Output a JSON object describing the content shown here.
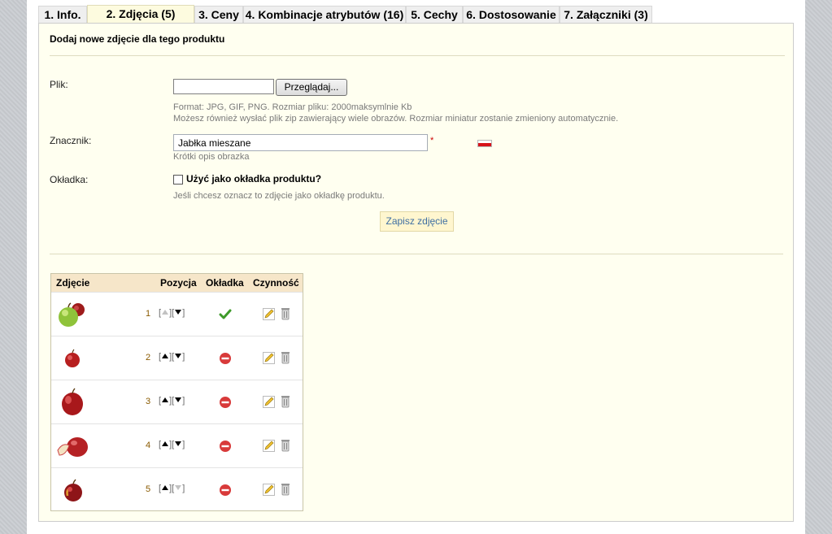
{
  "tabs": [
    {
      "label": "1. Info.",
      "active": false
    },
    {
      "label": "2. Zdjęcia (5)",
      "active": true
    },
    {
      "label": "3. Ceny",
      "active": false
    },
    {
      "label": "4. Kombinacje atrybutów (16)",
      "active": false
    },
    {
      "label": "5. Cechy",
      "active": false
    },
    {
      "label": "6. Dostosowanie",
      "active": false
    },
    {
      "label": "7. Załączniki (3)",
      "active": false
    }
  ],
  "form": {
    "heading": "Dodaj nowe zdjęcie dla tego produktu",
    "file_label": "Plik:",
    "browse_label": "Przeglądaj...",
    "file_hint_1": "Format: JPG, GIF, PNG. Rozmiar pliku: 2000maksymlnie Kb",
    "file_hint_2": "Możesz również wysłać plik zip zawierający wiele obrazów. Rozmiar miniatur zostanie zmieniony automatycznie.",
    "tag_label": "Znacznik:",
    "tag_value": "Jabłka mieszane",
    "required_mark": "*",
    "tag_hint": "Krótki opis obrazka",
    "cover_label": "Okładka:",
    "cover_checkbox_label": "Użyć jako okładka produktu?",
    "cover_hint": "Jeśli chcesz oznacz to zdjęcie jako okładkę produktu.",
    "save_label": "Zapisz zdjęcie",
    "language_flag_icon": "pl-flag-icon"
  },
  "table": {
    "headers": {
      "image": "Zdjęcie",
      "position": "Pozycja",
      "cover": "Okładka",
      "actions": "Czynność"
    },
    "rows": [
      {
        "position": "1",
        "up_enabled": false,
        "down_enabled": true,
        "is_cover": true,
        "thumb_icon": "green-red-apples"
      },
      {
        "position": "2",
        "up_enabled": true,
        "down_enabled": true,
        "is_cover": false,
        "thumb_icon": "small-red-apple"
      },
      {
        "position": "3",
        "up_enabled": true,
        "down_enabled": true,
        "is_cover": false,
        "thumb_icon": "red-apple"
      },
      {
        "position": "4",
        "up_enabled": true,
        "down_enabled": true,
        "is_cover": false,
        "thumb_icon": "sliced-red-apple"
      },
      {
        "position": "5",
        "up_enabled": true,
        "down_enabled": false,
        "is_cover": false,
        "thumb_icon": "dark-red-apple"
      }
    ]
  },
  "colors": {
    "panel_bg": "#fffff0",
    "active_tab_bg": "#fdfbdf",
    "table_header_bg": "#f6e6c9",
    "link_blue": "#3f6fa2"
  }
}
